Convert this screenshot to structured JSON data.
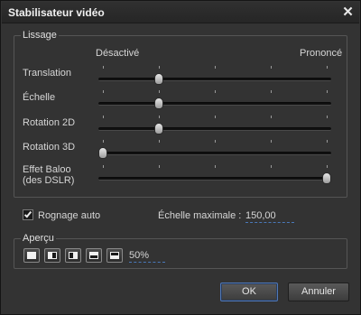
{
  "window": {
    "title": "Stabilisateur vidéo",
    "close_glyph": "✕"
  },
  "lissage": {
    "legend": "Lissage",
    "scale_min_label": "Désactivé",
    "scale_max_label": "Prononcé",
    "sliders": [
      {
        "label": "Translation",
        "value": 0.25
      },
      {
        "label": "Échelle",
        "value": 0.25
      },
      {
        "label": "Rotation 2D",
        "value": 0.25
      },
      {
        "label": "Rotation 3D",
        "value": 0.0
      },
      {
        "label_line1": "Effet Baloo",
        "label_line2": "(des DSLR)",
        "value": 1.0
      }
    ]
  },
  "options": {
    "rognage_label": "Rognage auto",
    "rognage_checked": true,
    "echelle_label": "Échelle maximale :",
    "echelle_value": "150,00"
  },
  "apercu": {
    "legend": "Aperçu",
    "buttons": [
      "full-view-icon",
      "split-left-icon",
      "split-right-icon",
      "split-top-icon",
      "split-bottom-icon"
    ],
    "zoom_value": "50%"
  },
  "buttons": {
    "ok": "OK",
    "cancel": "Annuler"
  }
}
